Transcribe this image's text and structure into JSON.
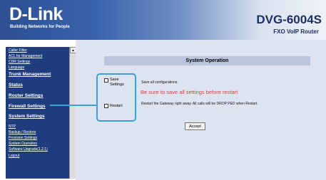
{
  "header": {
    "logo": "D-Link",
    "tagline": "Building Networks for People",
    "model": "DVG-6004S",
    "product": "FXO VoIP Router"
  },
  "sidebar": {
    "items": [
      {
        "label": "Caller Filter",
        "style": "small"
      },
      {
        "label": "ACL for Management",
        "style": "small"
      },
      {
        "label": "CDR Settings",
        "style": "small"
      },
      {
        "label": "Language",
        "style": "small"
      },
      {
        "label": "Trunk Management",
        "style": "big"
      },
      {
        "label": "Status",
        "style": "big"
      },
      {
        "label": "Router Settings",
        "style": "big"
      },
      {
        "label": "Firewall Settings",
        "style": "big"
      },
      {
        "label": "System Settings",
        "style": "big"
      },
      {
        "label": "NTP",
        "style": "small"
      },
      {
        "label": "Backup / Restore",
        "style": "small"
      },
      {
        "label": "Provision Settings",
        "style": "small"
      },
      {
        "label": "System Operation",
        "style": "small"
      },
      {
        "label": "Software Upgrade(1.2.1)",
        "style": "small"
      },
      {
        "label": "Logout",
        "style": "small"
      }
    ],
    "scroll_arrow": "▲"
  },
  "main": {
    "title": "System Operation",
    "save_label": "Save Settings",
    "save_desc": "Save all configurations.",
    "warning": "Be sure to save all settings before restart",
    "restart_label": "Restart",
    "restart_desc": "Restart the Gateway right away. All calls will be DROP PED when Restart.",
    "accept_label": "Accept"
  },
  "colors": {
    "sidebar_bg": "#1f3d7c",
    "content_bg": "#dde4ef",
    "title_bar_bg": "#b9c5da",
    "warning": "#e23b3b",
    "callout": "#3aa1d8"
  }
}
